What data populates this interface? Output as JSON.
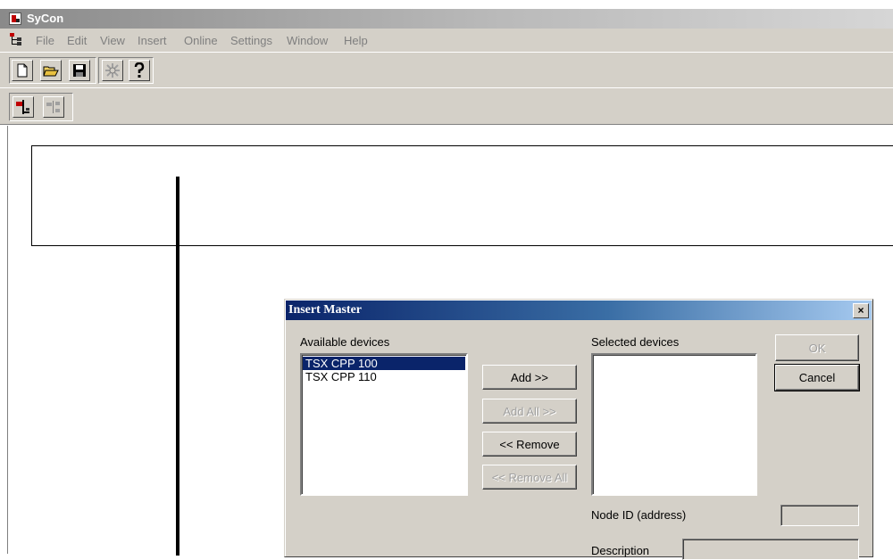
{
  "app": {
    "title": "SyCon"
  },
  "menu": {
    "items": [
      "File",
      "Edit",
      "View",
      "Insert",
      "Online",
      "Settings",
      "Window",
      "Help"
    ]
  },
  "toolbar": {
    "icons": [
      "new-file-icon",
      "open-folder-icon",
      "save-icon",
      "network-scan-icon",
      "help-icon"
    ],
    "mode_icons": [
      "bus-view-icon",
      "logical-view-icon"
    ]
  },
  "dialog": {
    "title": "Insert Master",
    "close_glyph": "×",
    "available_label": "Available devices",
    "available_devices": [
      "TSX CPP 100",
      "TSX CPP 110"
    ],
    "selected_label": "Selected devices",
    "buttons": {
      "add": "Add >>",
      "add_all": "Add All >>",
      "remove": "<< Remove",
      "remove_all": "<< Remove All",
      "ok": "OK",
      "cancel": "Cancel"
    },
    "node_id_label": "Node ID (address)",
    "node_id_value": "",
    "description_label": "Description",
    "description_value": ""
  },
  "colors": {
    "title_active": "#0a246a",
    "selection": "#0a246a",
    "face": "#d4d0c8"
  }
}
